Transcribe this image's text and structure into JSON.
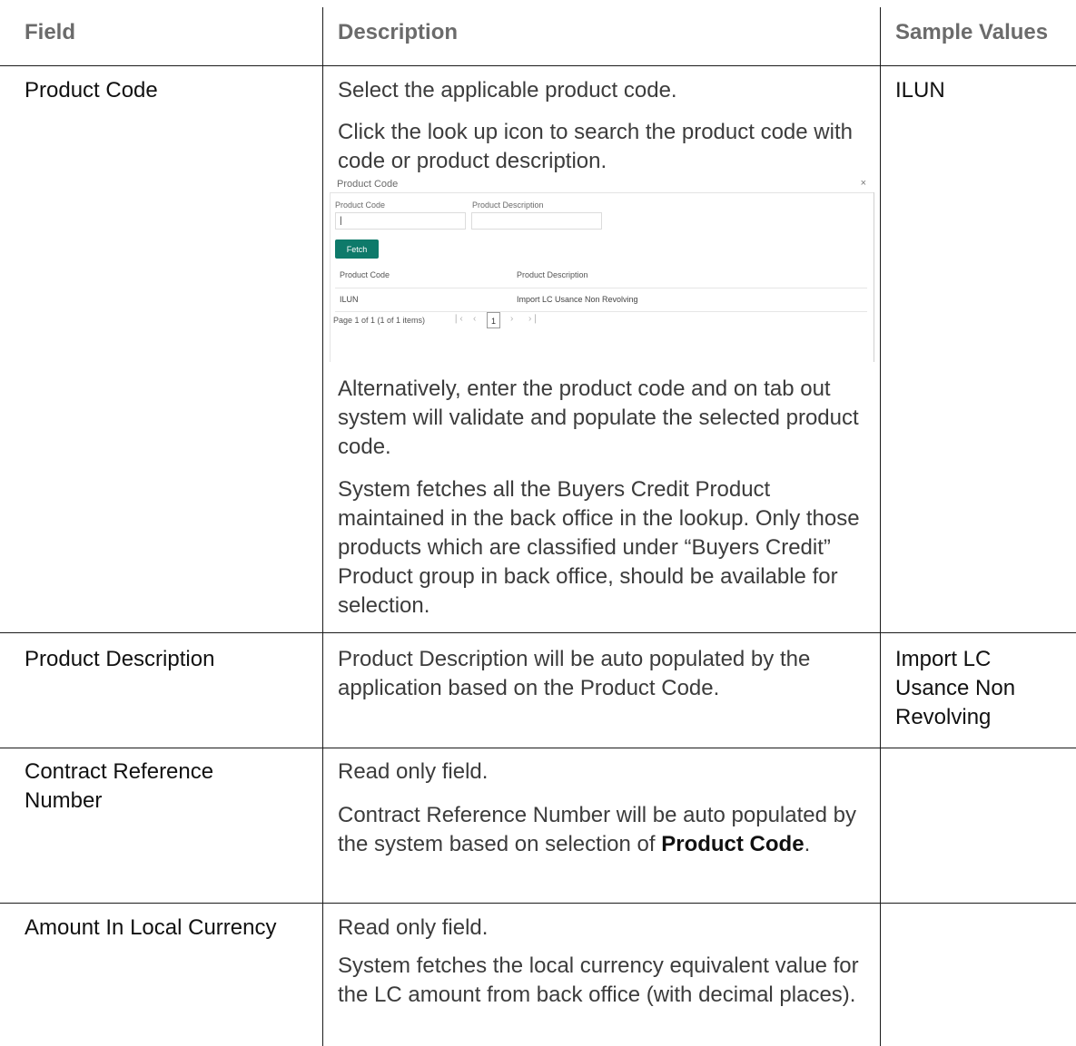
{
  "headers": {
    "field": "Field",
    "description": "Description",
    "sample_values": "Sample Values"
  },
  "rows": [
    {
      "field": "Product Code",
      "desc": [
        "Select the applicable product code.",
        "Click the look up icon to search the product code with code or product description.",
        "Alternatively, enter the product code and on tab out system will validate and populate the selected product code.",
        "System fetches all the Buyers Credit Product maintained in the back office in the lookup. Only those products which are classified under “Buyers Credit” Product group in back office, should be available for selection."
      ],
      "sample": "ILUN"
    },
    {
      "field": "Product Description",
      "desc": [
        "Product Description will be auto populated by the application based on the Product Code."
      ],
      "sample": "Import LC Usance Non Revolving"
    },
    {
      "field": "Contract Reference Number",
      "desc": [
        "Read only field.",
        "Contract Reference Number will be auto populated by the system based on selection of",
        "Product Code",
        "."
      ],
      "sample": ""
    },
    {
      "field": "Amount In Local Currency",
      "desc": [
        "Read only field.",
        "System fetches the local currency equivalent value for the LC amount from back office (with decimal places)."
      ],
      "sample": ""
    }
  ],
  "dialog": {
    "title": "Product Code",
    "close": "×",
    "product_code_label": "Product Code",
    "product_desc_label": "Product Description",
    "product_code_value": "|",
    "product_desc_value": "",
    "fetch": "Fetch",
    "columns": [
      "Product Code",
      "Product Description"
    ],
    "result": {
      "code": "ILUN",
      "description": "Import LC Usance Non Revolving"
    },
    "pager_text": "Page  1  of 1   (1 of 1 items)",
    "page_number": "1",
    "first_icon": "❘‹",
    "prev_icon": "‹",
    "next_icon": "›",
    "last_icon": "›❘"
  }
}
